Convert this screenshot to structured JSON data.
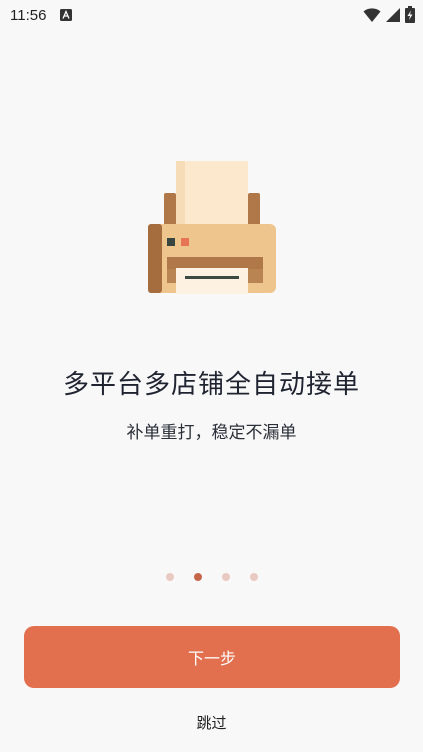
{
  "status_bar": {
    "time": "11:56",
    "notification_icon": "font-download-icon",
    "wifi_icon": "wifi-icon",
    "signal_icon": "cell-signal-icon",
    "battery_icon": "battery-charging-icon"
  },
  "onboarding": {
    "illustration_icon": "receipt-printer-icon",
    "title": "多平台多店铺全自动接单",
    "subtitle": "补单重打，稳定不漏单",
    "page_count": 4,
    "active_page": 2
  },
  "actions": {
    "next_label": "下一步",
    "skip_label": "跳过"
  },
  "colors": {
    "accent": "#e2704f",
    "dot_active": "#c5664b",
    "dot_inactive": "#e8cac2",
    "background": "#f8f8f8"
  }
}
